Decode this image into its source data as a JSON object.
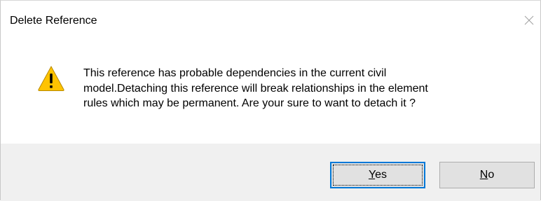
{
  "dialog": {
    "title": "Delete Reference",
    "message": "This reference has probable dependencies in the current civil\nmodel.Detaching this reference will break relationships in the element\nrules which may be permanent. Are your sure to want to detach it ?",
    "icon": "warning-icon",
    "close_icon": "close-icon"
  },
  "buttons": {
    "yes": {
      "mnemonic": "Y",
      "rest": "es"
    },
    "no": {
      "mnemonic": "N",
      "rest": "o"
    }
  },
  "colors": {
    "footer_bg": "#f0f0f0",
    "button_bg": "#e1e1e1",
    "focus_border": "#0078d7",
    "warning_yellow": "#ffc300"
  }
}
